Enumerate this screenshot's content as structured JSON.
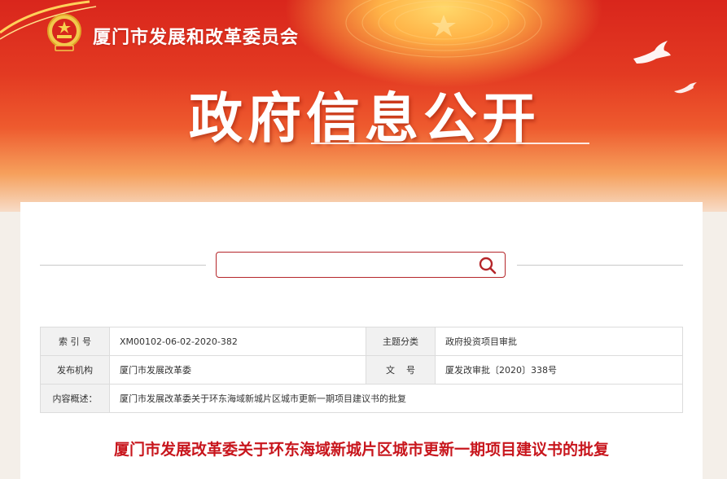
{
  "header": {
    "org_name": "厦门市发展和改革委员会",
    "banner_title": "政府信息公开"
  },
  "search": {
    "value": "",
    "placeholder": ""
  },
  "info": {
    "index_label": "索 引 号",
    "index_value": "XM00102-06-02-2020-382",
    "topic_label": "主题分类",
    "topic_value": "政府投资项目审批",
    "publisher_label": "发布机构",
    "publisher_value": "厦门市发展改革委",
    "docno_label": "文    号",
    "docno_value": "厦发改审批〔2020〕338号",
    "summary_label": "内容概述：",
    "summary_value": "厦门市发展改革委关于环东海域新城片区城市更新一期项目建议书的批复"
  },
  "document": {
    "title": "厦门市发展改革委关于环东海域新城片区城市更新一期项目建议书的批复"
  },
  "colors": {
    "banner_red": "#d9261c",
    "accent_red": "#c8161d",
    "search_border": "#b5262a"
  }
}
